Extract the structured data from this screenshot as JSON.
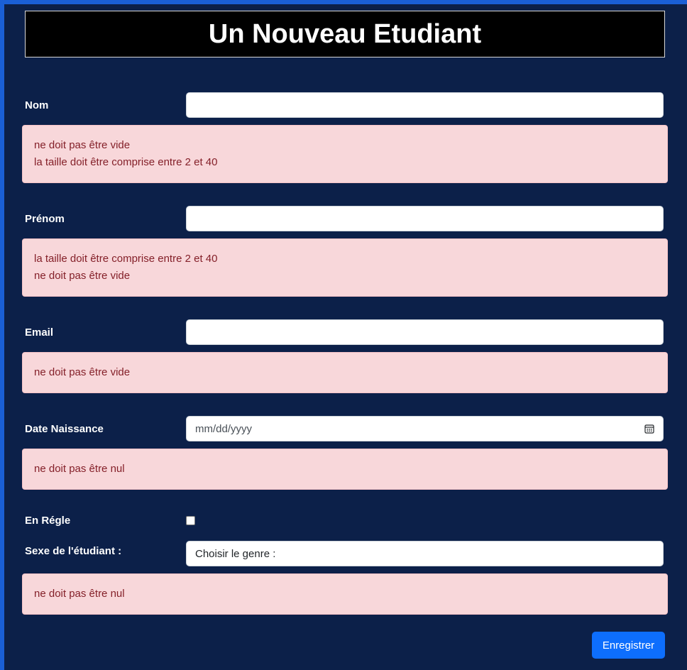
{
  "header": {
    "title": "Un Nouveau Etudiant"
  },
  "form": {
    "nom": {
      "label": "Nom",
      "value": "",
      "errors": [
        "ne doit pas être vide",
        "la taille doit être comprise entre 2 et 40"
      ]
    },
    "prenom": {
      "label": "Prénom",
      "value": "",
      "errors": [
        "la taille doit être comprise entre 2 et 40",
        "ne doit pas être vide"
      ]
    },
    "email": {
      "label": "Email",
      "value": "",
      "errors": [
        "ne doit pas être vide"
      ]
    },
    "date_naissance": {
      "label": "Date Naissance",
      "placeholder": "mm/dd/yyyy",
      "icon": "calendar-icon",
      "errors": [
        "ne doit pas être nul"
      ]
    },
    "en_regle": {
      "label": "En Régle",
      "checked": false
    },
    "sexe": {
      "label": "Sexe de l'étudiant :",
      "selected": "Choisir le genre :",
      "errors": [
        "ne doit pas être nul"
      ]
    },
    "submit_label": "Enregistrer"
  },
  "colors": {
    "background": "#0c2049",
    "accent": "#0d6efd",
    "alert_bg": "#f8d7da",
    "alert_text": "#842029"
  }
}
